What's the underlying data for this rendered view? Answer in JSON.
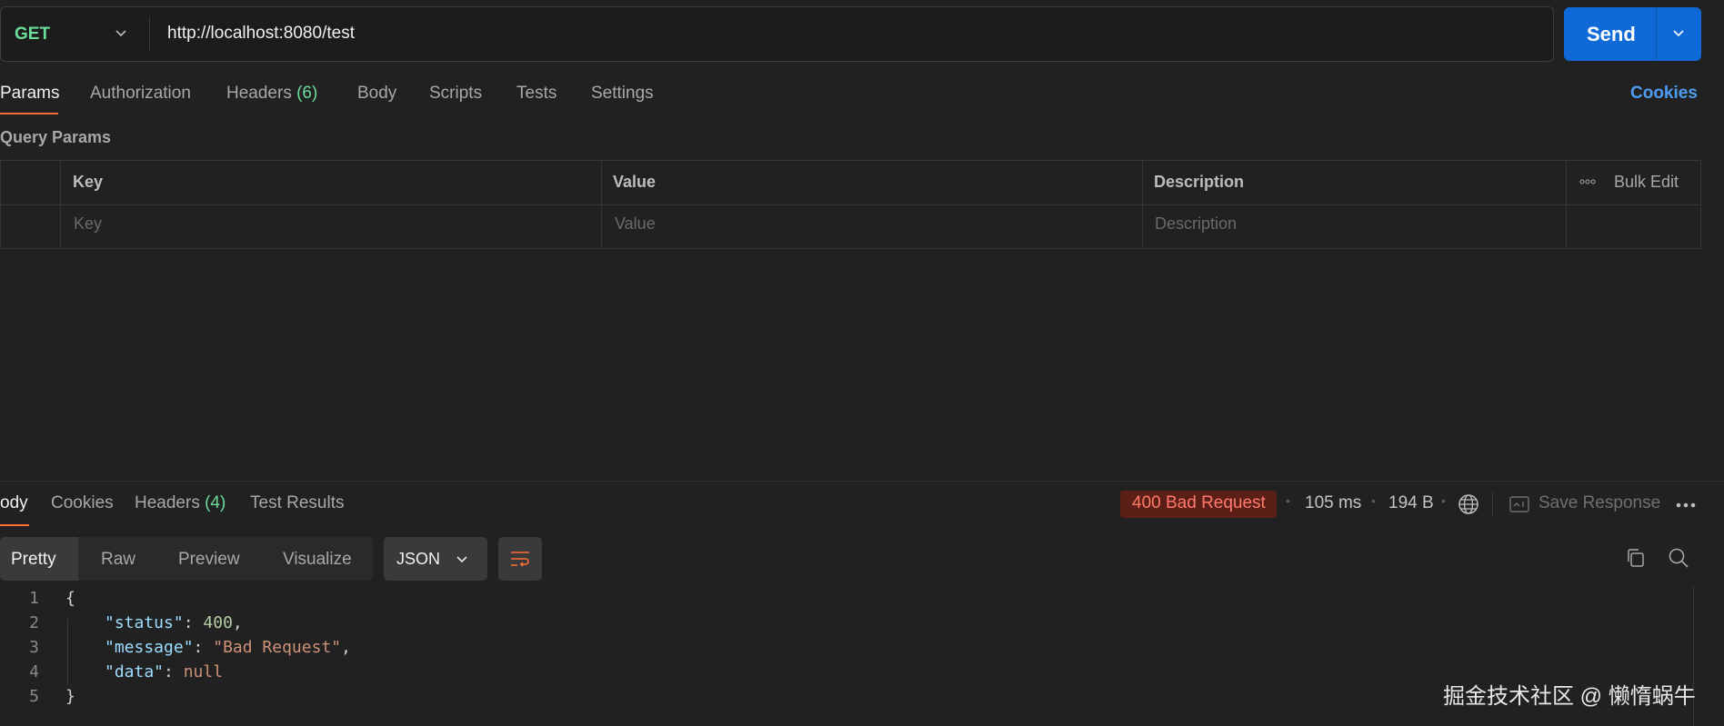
{
  "request": {
    "method": "GET",
    "url": "http://localhost:8080/test",
    "send_label": "Send"
  },
  "tabs": {
    "params": "Params",
    "authorization": "Authorization",
    "headers": "Headers",
    "headers_count": "(6)",
    "body": "Body",
    "scripts": "Scripts",
    "tests": "Tests",
    "settings": "Settings",
    "cookies": "Cookies"
  },
  "query_params": {
    "title": "Query Params",
    "columns": {
      "key": "Key",
      "value": "Value",
      "description": "Description"
    },
    "bulk_edit": "Bulk Edit",
    "placeholders": {
      "key": "Key",
      "value": "Value",
      "description": "Description"
    }
  },
  "response": {
    "tabs": {
      "body": "ody",
      "cookies": "Cookies",
      "headers": "Headers",
      "headers_count": "(4)",
      "test_results": "Test Results"
    },
    "status": "400 Bad Request",
    "time": "105 ms",
    "size": "194 B",
    "save_response": "Save Response",
    "views": {
      "pretty": "Pretty",
      "raw": "Raw",
      "preview": "Preview",
      "visualize": "Visualize"
    },
    "format": "JSON",
    "code": {
      "line_numbers": [
        "1",
        "2",
        "3",
        "4",
        "5"
      ],
      "open_brace": "{",
      "close_brace": "}",
      "status_key": "\"status\"",
      "status_value": "400",
      "message_key": "\"message\"",
      "message_value": "\"Bad Request\"",
      "data_key": "\"data\"",
      "data_value": "null"
    }
  },
  "watermark": "掘金技术社区 @ 懒惰蜗牛",
  "colors": {
    "accent_orange": "#ff6c37",
    "send_blue": "#0f6ad8",
    "method_green": "#6bdd9a",
    "cookies_link": "#4d9cf0",
    "status_error": "#ff7a6b"
  }
}
